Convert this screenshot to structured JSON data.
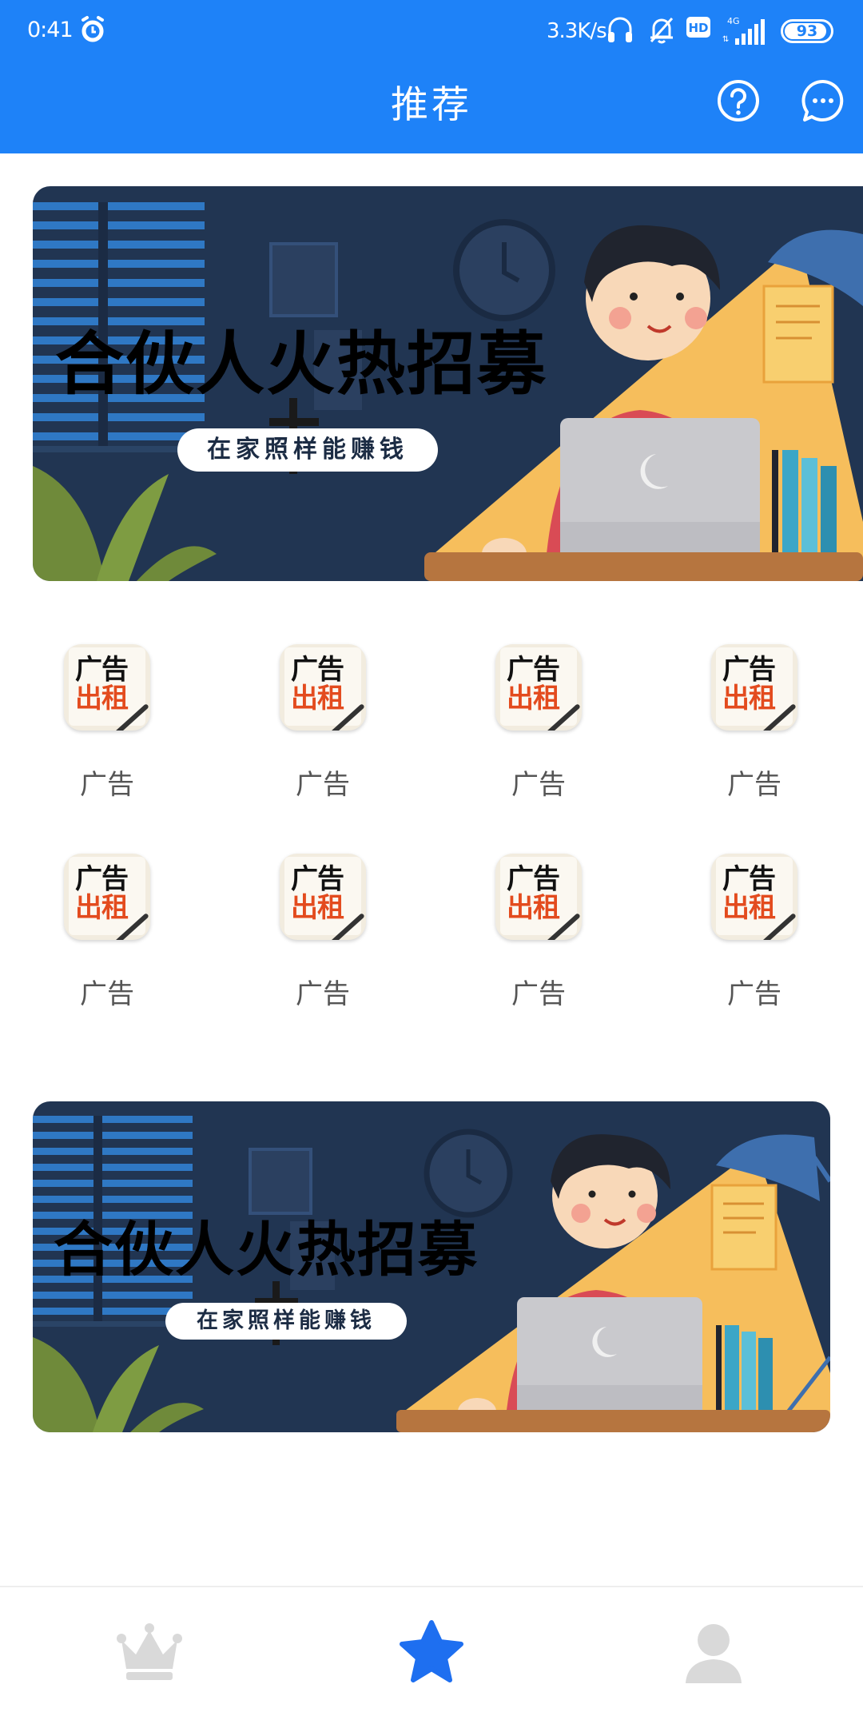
{
  "status_bar": {
    "time": "0:41",
    "net_speed": "3.3K/s",
    "network_type": "4G",
    "battery": "93",
    "battery_level_percent": 93,
    "icons": [
      "alarm-icon",
      "headset-icon",
      "mute-bell-icon",
      "hd-icon",
      "signal-icon",
      "battery-icon"
    ]
  },
  "header": {
    "title": "推荐",
    "actions": [
      "help-icon",
      "message-icon"
    ]
  },
  "banners": [
    {
      "title": "合伙人火热招募",
      "subtitle": "在家照样能赚钱"
    },
    {
      "title": "合伙人火热招募",
      "subtitle": "在家照样能赚钱"
    }
  ],
  "ad_icon_text": {
    "line1": "广告",
    "line2": "出租"
  },
  "grid": [
    {
      "label": "广告"
    },
    {
      "label": "广告"
    },
    {
      "label": "广告"
    },
    {
      "label": "广告"
    },
    {
      "label": "广告"
    },
    {
      "label": "广告"
    },
    {
      "label": "广告"
    },
    {
      "label": "广告"
    }
  ],
  "tabs": [
    {
      "icon": "crown-icon",
      "active": false
    },
    {
      "icon": "star-icon",
      "active": true
    },
    {
      "icon": "person-icon",
      "active": false
    }
  ],
  "colors": {
    "primary": "#1e82f8",
    "tab_inactive": "#d9d9d9",
    "ad_red": "#e34b1e",
    "banner_bg": "#213552"
  }
}
